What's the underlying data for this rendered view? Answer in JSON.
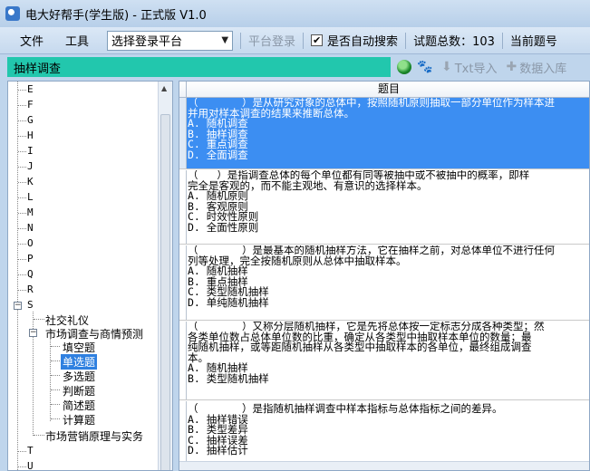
{
  "window": {
    "title": "电大好帮手(学生版) - 正式版 V1.0"
  },
  "menubar": {
    "file_label": "文件",
    "tools_label": "工具",
    "platform_select": {
      "value": "选择登录平台"
    },
    "platform_login_label": "平台登录",
    "auto_search": {
      "label": "是否自动搜索",
      "checked": true,
      "check_glyph": "✔"
    },
    "total_label": "试题总数：103",
    "current_label": "当前题号"
  },
  "searchrow": {
    "search_value": "抽样调查",
    "txt_import_label": "Txt导入",
    "db_import_label": "数据入库"
  },
  "tree": {
    "letters": [
      "E",
      "F",
      "G",
      "H",
      "I",
      "J",
      "K",
      "L",
      "M",
      "N",
      "O",
      "P",
      "Q",
      "R",
      "S",
      "T",
      "U"
    ],
    "s_expander": "−",
    "s_children": [
      {
        "label": "社交礼仪"
      },
      {
        "label": "市场调查与商情预测",
        "expander": "−"
      },
      {
        "label": "市场营销原理与实务"
      }
    ],
    "leaf_items": [
      "填空题",
      "单选题",
      "多选题",
      "判断题",
      "简述题",
      "计算题"
    ],
    "selected": "单选题"
  },
  "grid": {
    "column_header": "题目",
    "rows": [
      {
        "lines": [
          "（       ）是从研究对象的总体中，按照随机原则抽取一部分单位作为样本进",
          "并用对样本调查的结果来推断总体。",
          "A. 随机调查",
          "B. 抽样调查",
          "C. 重点调查",
          "D. 全面调查"
        ],
        "selected": true
      },
      {
        "lines": [
          "（   ）是指调查总体的每个单位都有同等被抽中或不被抽中的概率，即样",
          "完全是客观的，而不能主观地、有意识的选择样本。",
          "A. 随机原则",
          "B. 客观原则",
          "C. 时效性原则",
          "D. 全面性原则"
        ],
        "selected": false
      },
      {
        "lines": [
          "（       ）是最基本的随机抽样方法，它在抽样之前，对总体单位不进行任何",
          "列等处理，完全按随机原则从总体中抽取样本。",
          "A. 随机抽样",
          "B. 重点抽样",
          "C. 类型随机抽样",
          "D. 单纯随机抽样"
        ],
        "selected": false
      },
      {
        "lines": [
          "（       ）又称分层随机抽样，它是先将总体按一定标志分成各种类型；然",
          "各类单位数占总体单位数的比重，确定从各类型中抽取样本单位的数量；最",
          "纯随机抽样，或等距随机抽样从各类型中抽取样本的各单位，最终组成调查",
          "本。",
          "A. 随机抽样",
          "B. 类型随机抽样"
        ],
        "selected": false
      },
      {
        "lines": [
          "（       ）是指随机抽样调查中样本指标与总体指标之间的差异。",
          "A. 抽样错误",
          "B. 类型差异",
          "C. 抽样误差",
          "D. 抽样估计"
        ],
        "selected": false
      }
    ]
  }
}
